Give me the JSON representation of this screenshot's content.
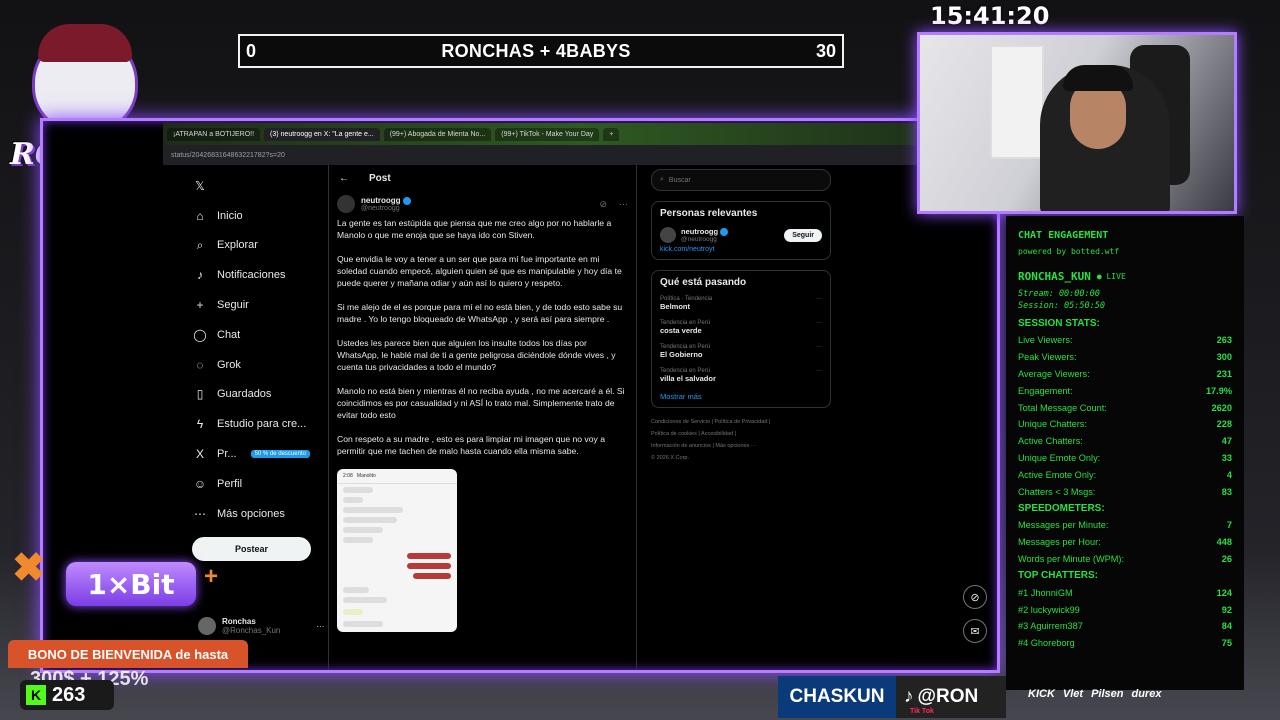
{
  "overlay": {
    "clock": "15:41:20",
    "scoreboard": {
      "left": "0",
      "title": "RONCHAS + 4BABYS",
      "right": "30"
    },
    "logo_text": "RONCHAS",
    "bit_label": "1×Bit",
    "bono_label": "BONO DE BIENVENIDA de hasta",
    "promo_text": "300$ + 125%",
    "kick_count": "263",
    "chaskun_label": "CHASKUN",
    "tiktok_handle": "@RON",
    "tiktok_small": "Tik Tok",
    "sponsors": [
      "KICK",
      "Vlet",
      "Pilsen",
      "durex"
    ]
  },
  "browser": {
    "tabs": [
      {
        "label": "¡ATRAPAN a BOTIJERO!!",
        "active": false
      },
      {
        "label": "(3) neutroogg en X: \"La gente e...",
        "active": true
      },
      {
        "label": "(99+) Abogada de Mienta No...",
        "active": false
      },
      {
        "label": "(99+) TikTok - Make Your Day",
        "active": false
      }
    ],
    "url": "status/2042683164863221782?s=20"
  },
  "nav": {
    "items": [
      {
        "icon": "home-icon",
        "glyph": "⌂",
        "label": "Inicio"
      },
      {
        "icon": "search-icon",
        "glyph": "⌕",
        "label": "Explorar"
      },
      {
        "icon": "bell-icon",
        "glyph": "♪",
        "label": "Notificaciones"
      },
      {
        "icon": "follow-icon",
        "glyph": "+",
        "label": "Seguir"
      },
      {
        "icon": "chat-icon",
        "glyph": "◯",
        "label": "Chat"
      },
      {
        "icon": "grok-icon",
        "glyph": "◌",
        "label": "Grok"
      },
      {
        "icon": "bookmark-icon",
        "glyph": "▯",
        "label": "Guardados"
      },
      {
        "icon": "lightning-icon",
        "glyph": "ϟ",
        "label": "Estudio para cre..."
      },
      {
        "icon": "x-logo-icon",
        "glyph": "X",
        "label": "Pr...",
        "badge": "50 % de descuento"
      },
      {
        "icon": "profile-icon",
        "glyph": "☺",
        "label": "Perfil"
      },
      {
        "icon": "more-icon",
        "glyph": "⋯",
        "label": "Más opciones"
      }
    ],
    "post_button": "Postear",
    "account_name": "Ronchas",
    "account_handle": "@Ronchas_Kun"
  },
  "post": {
    "header": "Post",
    "author_name": "neutroogg",
    "author_handle": "@neutroogg",
    "paragraphs": [
      "La gente es tan estúpida que piensa que me creo algo por no hablarle a Manolo o que me enoja que se haya ido con Stiven.",
      "Que envidia le voy a tener a un ser que para mí fue importante en mi soledad cuando empecé, alguien quien sé que es manipulable y hoy día te puede querer y mañana odiar y aún así lo quiero y respeto.",
      "Si me alejo de el es porque para mí el no está bien, y de todo esto sabe su madre . Yo lo tengo bloqueado de WhatsApp , y será así para siempre .",
      "Ustedes les parece bien que alguien los insulte todos los días por WhatsApp, le hablé mal de ti a gente peligrosa diciéndole dónde vives , y cuenta tus privacidades a todo el mundo?",
      "Manolo no está bien y mientras él no reciba ayuda , no me acercaré a él. Si coincidimos es por casualidad y ni ASÍ lo trato mal. Simplemente trato de evitar todo esto",
      "Con respeto a su madre , esto es para limpiar mi imagen que no voy a permitir que me tachen de malo hasta cuando ella misma sabe."
    ],
    "screenshot": {
      "time": "2:08",
      "contact": "Manolito"
    }
  },
  "right": {
    "search_placeholder": "Buscar",
    "relevant_title": "Personas relevantes",
    "relevant_name": "neutroogg",
    "relevant_handle": "@neutroogg",
    "relevant_link": "kick.com/neutroyt",
    "follow_label": "Seguir",
    "trending_title": "Qué está pasando",
    "trends": [
      {
        "context": "Política · Tendencia",
        "topic": "Belmont"
      },
      {
        "context": "Tendencia en Perú",
        "topic": "costa verde"
      },
      {
        "context": "Tendencia en Perú",
        "topic": "El Gobierno"
      },
      {
        "context": "Tendencia en Perú",
        "topic": "villa el salvador"
      }
    ],
    "show_more": "Mostrar más",
    "footer_lines": [
      "Condiciones de Servicio  |  Política de Privacidad  |",
      "Política de cookies  |  Accesibilidad  |",
      "Información de anuncios  |  Más opciones ···",
      "© 2026 X Corp."
    ]
  },
  "chat_panel": {
    "title": "CHAT ENGAGEMENT",
    "powered": "powered by botted.wtf",
    "channel": "RONCHAS_KUN",
    "live": "● LIVE",
    "stream": "Stream: 00:00:00",
    "session": "Session: 05:50:50",
    "session_stats_title": "SESSION STATS:",
    "session_stats": [
      {
        "label": "Live Viewers:",
        "value": "263"
      },
      {
        "label": "Peak Viewers:",
        "value": "300"
      },
      {
        "label": "Average Viewers:",
        "value": "231"
      },
      {
        "label": "Engagement:",
        "value": "17.9%"
      },
      {
        "label": "Total Message Count:",
        "value": "2620"
      },
      {
        "label": "Unique Chatters:",
        "value": "228"
      },
      {
        "label": "Active Chatters:",
        "value": "47"
      },
      {
        "label": "Unique Emote Only:",
        "value": "33"
      },
      {
        "label": "Active Emote Only:",
        "value": "4"
      },
      {
        "label": "Chatters < 3 Msgs:",
        "value": "83"
      }
    ],
    "speedometers_title": "SPEEDOMETERS:",
    "speedometers": [
      {
        "label": "Messages per Minute:",
        "value": "7"
      },
      {
        "label": "Messages per Hour:",
        "value": "448"
      },
      {
        "label": "Words per Minute (WPM):",
        "value": "26"
      }
    ],
    "top_title": "TOP CHATTERS:",
    "top_chatters": [
      {
        "label": "#1 JhonniGM",
        "value": "124"
      },
      {
        "label": "#2 luckywick99",
        "value": "92"
      },
      {
        "label": "#3 Aguirrem387",
        "value": "84"
      },
      {
        "label": "#4 Ghoreborg",
        "value": "75"
      }
    ]
  }
}
